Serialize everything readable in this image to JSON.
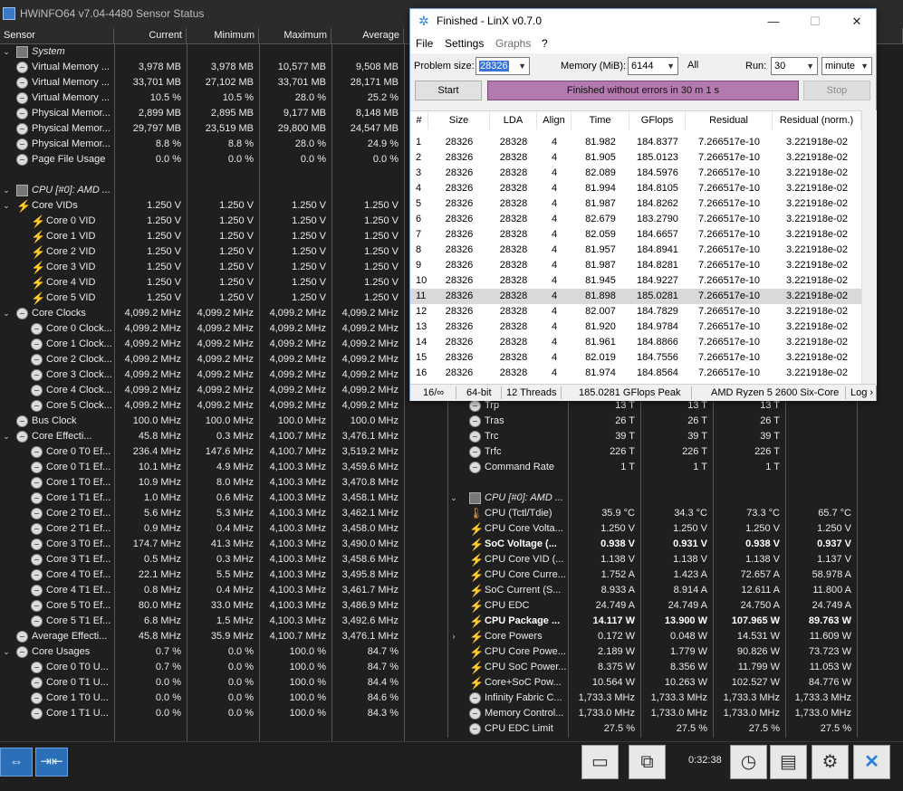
{
  "hwinfo": {
    "title": "HWiNFO64 v7.04-4480 Sensor Status",
    "columns": [
      "Sensor",
      "Current",
      "Minimum",
      "Maximum",
      "Average"
    ],
    "left_rows": [
      {
        "indent": 0,
        "kind": "group",
        "icon": "chip-icon",
        "label": "System",
        "cur": "",
        "min": "",
        "max": "",
        "avg": ""
      },
      {
        "indent": 1,
        "kind": "item",
        "icon": "circle-gauge-icon",
        "label": "Virtual Memory ...",
        "cur": "3,978 MB",
        "min": "3,978 MB",
        "max": "10,577 MB",
        "avg": "9,508 MB"
      },
      {
        "indent": 1,
        "kind": "item",
        "icon": "circle-gauge-icon",
        "label": "Virtual Memory ...",
        "cur": "33,701 MB",
        "min": "27,102 MB",
        "max": "33,701 MB",
        "avg": "28,171 MB"
      },
      {
        "indent": 1,
        "kind": "item",
        "icon": "circle-gauge-icon",
        "label": "Virtual Memory ...",
        "cur": "10.5 %",
        "min": "10.5 %",
        "max": "28.0 %",
        "avg": "25.2 %"
      },
      {
        "indent": 1,
        "kind": "item",
        "icon": "circle-gauge-icon",
        "label": "Physical Memor...",
        "cur": "2,899 MB",
        "min": "2,895 MB",
        "max": "9,177 MB",
        "avg": "8,148 MB"
      },
      {
        "indent": 1,
        "kind": "item",
        "icon": "circle-gauge-icon",
        "label": "Physical Memor...",
        "cur": "29,797 MB",
        "min": "23,519 MB",
        "max": "29,800 MB",
        "avg": "24,547 MB"
      },
      {
        "indent": 1,
        "kind": "item",
        "icon": "circle-gauge-icon",
        "label": "Physical Memor...",
        "cur": "8.8 %",
        "min": "8.8 %",
        "max": "28.0 %",
        "avg": "24.9 %"
      },
      {
        "indent": 1,
        "kind": "item",
        "icon": "circle-gauge-icon",
        "label": "Page File Usage",
        "cur": "0.0 %",
        "min": "0.0 %",
        "max": "0.0 %",
        "avg": "0.0 %"
      },
      {
        "indent": 0,
        "kind": "blank",
        "icon": "",
        "label": "",
        "cur": "",
        "min": "",
        "max": "",
        "avg": ""
      },
      {
        "indent": 0,
        "kind": "group",
        "icon": "chip-icon",
        "label": "CPU [#0]: AMD ...",
        "cur": "",
        "min": "",
        "max": "",
        "avg": ""
      },
      {
        "indent": 1,
        "kind": "parent",
        "icon": "bolt-icon",
        "label": "Core VIDs",
        "cur": "1.250 V",
        "min": "1.250 V",
        "max": "1.250 V",
        "avg": "1.250 V"
      },
      {
        "indent": 2,
        "kind": "item",
        "icon": "bolt-icon",
        "label": "Core 0 VID",
        "cur": "1.250 V",
        "min": "1.250 V",
        "max": "1.250 V",
        "avg": "1.250 V"
      },
      {
        "indent": 2,
        "kind": "item",
        "icon": "bolt-icon",
        "label": "Core 1 VID",
        "cur": "1.250 V",
        "min": "1.250 V",
        "max": "1.250 V",
        "avg": "1.250 V"
      },
      {
        "indent": 2,
        "kind": "item",
        "icon": "bolt-icon",
        "label": "Core 2 VID",
        "cur": "1.250 V",
        "min": "1.250 V",
        "max": "1.250 V",
        "avg": "1.250 V"
      },
      {
        "indent": 2,
        "kind": "item",
        "icon": "bolt-icon",
        "label": "Core 3 VID",
        "cur": "1.250 V",
        "min": "1.250 V",
        "max": "1.250 V",
        "avg": "1.250 V"
      },
      {
        "indent": 2,
        "kind": "item",
        "icon": "bolt-icon",
        "label": "Core 4 VID",
        "cur": "1.250 V",
        "min": "1.250 V",
        "max": "1.250 V",
        "avg": "1.250 V"
      },
      {
        "indent": 2,
        "kind": "item",
        "icon": "bolt-icon",
        "label": "Core 5 VID",
        "cur": "1.250 V",
        "min": "1.250 V",
        "max": "1.250 V",
        "avg": "1.250 V"
      },
      {
        "indent": 1,
        "kind": "parent",
        "icon": "circle-gauge-icon",
        "label": "Core Clocks",
        "cur": "4,099.2 MHz",
        "min": "4,099.2 MHz",
        "max": "4,099.2 MHz",
        "avg": "4,099.2 MHz"
      },
      {
        "indent": 2,
        "kind": "item",
        "icon": "circle-gauge-icon",
        "label": "Core 0 Clock...",
        "cur": "4,099.2 MHz",
        "min": "4,099.2 MHz",
        "max": "4,099.2 MHz",
        "avg": "4,099.2 MHz"
      },
      {
        "indent": 2,
        "kind": "item",
        "icon": "circle-gauge-icon",
        "label": "Core 1 Clock...",
        "cur": "4,099.2 MHz",
        "min": "4,099.2 MHz",
        "max": "4,099.2 MHz",
        "avg": "4,099.2 MHz"
      },
      {
        "indent": 2,
        "kind": "item",
        "icon": "circle-gauge-icon",
        "label": "Core 2 Clock...",
        "cur": "4,099.2 MHz",
        "min": "4,099.2 MHz",
        "max": "4,099.2 MHz",
        "avg": "4,099.2 MHz"
      },
      {
        "indent": 2,
        "kind": "item",
        "icon": "circle-gauge-icon",
        "label": "Core 3 Clock...",
        "cur": "4,099.2 MHz",
        "min": "4,099.2 MHz",
        "max": "4,099.2 MHz",
        "avg": "4,099.2 MHz"
      },
      {
        "indent": 2,
        "kind": "item",
        "icon": "circle-gauge-icon",
        "label": "Core 4 Clock...",
        "cur": "4,099.2 MHz",
        "min": "4,099.2 MHz",
        "max": "4,099.2 MHz",
        "avg": "4,099.2 MHz"
      },
      {
        "indent": 2,
        "kind": "item",
        "icon": "circle-gauge-icon",
        "label": "Core 5 Clock...",
        "cur": "4,099.2 MHz",
        "min": "4,099.2 MHz",
        "max": "4,099.2 MHz",
        "avg": "4,099.2 MHz"
      },
      {
        "indent": 1,
        "kind": "item",
        "icon": "circle-gauge-icon",
        "label": "Bus Clock",
        "cur": "100.0 MHz",
        "min": "100.0 MHz",
        "max": "100.0 MHz",
        "avg": "100.0 MHz"
      },
      {
        "indent": 1,
        "kind": "parent",
        "icon": "circle-gauge-icon",
        "label": "Core Effecti...",
        "cur": "45.8 MHz",
        "min": "0.3 MHz",
        "max": "4,100.7 MHz",
        "avg": "3,476.1 MHz"
      },
      {
        "indent": 2,
        "kind": "item",
        "icon": "circle-gauge-icon",
        "label": "Core 0 T0 Ef...",
        "cur": "236.4 MHz",
        "min": "147.6 MHz",
        "max": "4,100.7 MHz",
        "avg": "3,519.2 MHz"
      },
      {
        "indent": 2,
        "kind": "item",
        "icon": "circle-gauge-icon",
        "label": "Core 0 T1 Ef...",
        "cur": "10.1 MHz",
        "min": "4.9 MHz",
        "max": "4,100.3 MHz",
        "avg": "3,459.6 MHz"
      },
      {
        "indent": 2,
        "kind": "item",
        "icon": "circle-gauge-icon",
        "label": "Core 1 T0 Ef...",
        "cur": "10.9 MHz",
        "min": "8.0 MHz",
        "max": "4,100.3 MHz",
        "avg": "3,470.8 MHz"
      },
      {
        "indent": 2,
        "kind": "item",
        "icon": "circle-gauge-icon",
        "label": "Core 1 T1 Ef...",
        "cur": "1.0 MHz",
        "min": "0.6 MHz",
        "max": "4,100.3 MHz",
        "avg": "3,458.1 MHz"
      },
      {
        "indent": 2,
        "kind": "item",
        "icon": "circle-gauge-icon",
        "label": "Core 2 T0 Ef...",
        "cur": "5.6 MHz",
        "min": "5.3 MHz",
        "max": "4,100.3 MHz",
        "avg": "3,462.1 MHz"
      },
      {
        "indent": 2,
        "kind": "item",
        "icon": "circle-gauge-icon",
        "label": "Core 2 T1 Ef...",
        "cur": "0.9 MHz",
        "min": "0.4 MHz",
        "max": "4,100.3 MHz",
        "avg": "3,458.0 MHz"
      },
      {
        "indent": 2,
        "kind": "item",
        "icon": "circle-gauge-icon",
        "label": "Core 3 T0 Ef...",
        "cur": "174.7 MHz",
        "min": "41.3 MHz",
        "max": "4,100.3 MHz",
        "avg": "3,490.0 MHz"
      },
      {
        "indent": 2,
        "kind": "item",
        "icon": "circle-gauge-icon",
        "label": "Core 3 T1 Ef...",
        "cur": "0.5 MHz",
        "min": "0.3 MHz",
        "max": "4,100.3 MHz",
        "avg": "3,458.6 MHz"
      },
      {
        "indent": 2,
        "kind": "item",
        "icon": "circle-gauge-icon",
        "label": "Core 4 T0 Ef...",
        "cur": "22.1 MHz",
        "min": "5.5 MHz",
        "max": "4,100.3 MHz",
        "avg": "3,495.8 MHz"
      },
      {
        "indent": 2,
        "kind": "item",
        "icon": "circle-gauge-icon",
        "label": "Core 4 T1 Ef...",
        "cur": "0.8 MHz",
        "min": "0.4 MHz",
        "max": "4,100.3 MHz",
        "avg": "3,461.7 MHz"
      },
      {
        "indent": 2,
        "kind": "item",
        "icon": "circle-gauge-icon",
        "label": "Core 5 T0 Ef...",
        "cur": "80.0 MHz",
        "min": "33.0 MHz",
        "max": "4,100.3 MHz",
        "avg": "3,486.9 MHz"
      },
      {
        "indent": 2,
        "kind": "item",
        "icon": "circle-gauge-icon",
        "label": "Core 5 T1 Ef...",
        "cur": "6.8 MHz",
        "min": "1.5 MHz",
        "max": "4,100.3 MHz",
        "avg": "3,492.6 MHz"
      },
      {
        "indent": 1,
        "kind": "item",
        "icon": "circle-gauge-icon",
        "label": "Average Effecti...",
        "cur": "45.8 MHz",
        "min": "35.9 MHz",
        "max": "4,100.7 MHz",
        "avg": "3,476.1 MHz"
      },
      {
        "indent": 1,
        "kind": "parent",
        "icon": "circle-gauge-icon",
        "label": "Core Usages",
        "cur": "0.7 %",
        "min": "0.0 %",
        "max": "100.0 %",
        "avg": "84.7 %"
      },
      {
        "indent": 2,
        "kind": "item",
        "icon": "circle-gauge-icon",
        "label": "Core 0 T0 U...",
        "cur": "0.7 %",
        "min": "0.0 %",
        "max": "100.0 %",
        "avg": "84.7 %"
      },
      {
        "indent": 2,
        "kind": "item",
        "icon": "circle-gauge-icon",
        "label": "Core 0 T1 U...",
        "cur": "0.0 %",
        "min": "0.0 %",
        "max": "100.0 %",
        "avg": "84.4 %"
      },
      {
        "indent": 2,
        "kind": "item",
        "icon": "circle-gauge-icon",
        "label": "Core 1 T0 U...",
        "cur": "0.0 %",
        "min": "0.0 %",
        "max": "100.0 %",
        "avg": "84.6 %"
      },
      {
        "indent": 2,
        "kind": "item",
        "icon": "circle-gauge-icon",
        "label": "Core 1 T1 U...",
        "cur": "0.0 %",
        "min": "0.0 %",
        "max": "100.0 %",
        "avg": "84.3 %"
      }
    ],
    "right_rows": [
      {
        "indent": 1,
        "kind": "item",
        "icon": "circle-gauge-icon",
        "bold": false,
        "label": "Trp",
        "cur": "13 T",
        "min": "13 T",
        "max": "13 T",
        "avg": ""
      },
      {
        "indent": 1,
        "kind": "item",
        "icon": "circle-gauge-icon",
        "bold": false,
        "label": "Tras",
        "cur": "26 T",
        "min": "26 T",
        "max": "26 T",
        "avg": ""
      },
      {
        "indent": 1,
        "kind": "item",
        "icon": "circle-gauge-icon",
        "bold": false,
        "label": "Trc",
        "cur": "39 T",
        "min": "39 T",
        "max": "39 T",
        "avg": ""
      },
      {
        "indent": 1,
        "kind": "item",
        "icon": "circle-gauge-icon",
        "bold": false,
        "label": "Trfc",
        "cur": "226 T",
        "min": "226 T",
        "max": "226 T",
        "avg": ""
      },
      {
        "indent": 1,
        "kind": "item",
        "icon": "circle-gauge-icon",
        "bold": false,
        "label": "Command Rate",
        "cur": "1 T",
        "min": "1 T",
        "max": "1 T",
        "avg": ""
      },
      {
        "indent": 0,
        "kind": "blank",
        "icon": "",
        "bold": false,
        "label": "",
        "cur": "",
        "min": "",
        "max": "",
        "avg": ""
      },
      {
        "indent": 0,
        "kind": "group",
        "icon": "chip-icon",
        "bold": false,
        "label": "CPU [#0]: AMD ...",
        "cur": "",
        "min": "",
        "max": "",
        "avg": ""
      },
      {
        "indent": 1,
        "kind": "item",
        "icon": "thermometer-icon",
        "bold": false,
        "label": "CPU (Tctl/Tdie)",
        "cur": "35.9 °C",
        "min": "34.3 °C",
        "max": "73.3 °C",
        "avg": "65.7 °C"
      },
      {
        "indent": 1,
        "kind": "item",
        "icon": "bolt-icon",
        "bold": false,
        "label": "CPU Core Volta...",
        "cur": "1.250 V",
        "min": "1.250 V",
        "max": "1.250 V",
        "avg": "1.250 V"
      },
      {
        "indent": 1,
        "kind": "item",
        "icon": "bolt-icon",
        "bold": true,
        "label": "SoC Voltage (...",
        "cur": "0.938 V",
        "min": "0.931 V",
        "max": "0.938 V",
        "avg": "0.937 V"
      },
      {
        "indent": 1,
        "kind": "item",
        "icon": "bolt-icon",
        "bold": false,
        "label": "CPU Core VID (...",
        "cur": "1.138 V",
        "min": "1.138 V",
        "max": "1.138 V",
        "avg": "1.137 V"
      },
      {
        "indent": 1,
        "kind": "item",
        "icon": "bolt-icon",
        "bold": false,
        "label": "CPU Core Curre...",
        "cur": "1.752 A",
        "min": "1.423 A",
        "max": "72.657 A",
        "avg": "58.978 A"
      },
      {
        "indent": 1,
        "kind": "item",
        "icon": "bolt-icon",
        "bold": false,
        "label": "SoC Current (S...",
        "cur": "8.933 A",
        "min": "8.914 A",
        "max": "12.611 A",
        "avg": "11.800 A"
      },
      {
        "indent": 1,
        "kind": "item",
        "icon": "bolt-icon",
        "bold": false,
        "label": "CPU EDC",
        "cur": "24.749 A",
        "min": "24.749 A",
        "max": "24.750 A",
        "avg": "24.749 A"
      },
      {
        "indent": 1,
        "kind": "item",
        "icon": "bolt-icon",
        "bold": true,
        "label": "CPU Package ...",
        "cur": "14.117 W",
        "min": "13.900 W",
        "max": "107.965 W",
        "avg": "89.763 W"
      },
      {
        "indent": 1,
        "kind": "parent-collapsed",
        "icon": "bolt-icon",
        "bold": false,
        "label": "Core Powers",
        "cur": "0.172 W",
        "min": "0.048 W",
        "max": "14.531 W",
        "avg": "11.609 W"
      },
      {
        "indent": 1,
        "kind": "item",
        "icon": "bolt-icon",
        "bold": false,
        "label": "CPU Core Powe...",
        "cur": "2.189 W",
        "min": "1.779 W",
        "max": "90.826 W",
        "avg": "73.723 W"
      },
      {
        "indent": 1,
        "kind": "item",
        "icon": "bolt-icon",
        "bold": false,
        "label": "CPU SoC Power...",
        "cur": "8.375 W",
        "min": "8.356 W",
        "max": "11.799 W",
        "avg": "11.053 W"
      },
      {
        "indent": 1,
        "kind": "item",
        "icon": "bolt-icon",
        "bold": false,
        "label": "Core+SoC Pow...",
        "cur": "10.564 W",
        "min": "10.263 W",
        "max": "102.527 W",
        "avg": "84.776 W"
      },
      {
        "indent": 1,
        "kind": "item",
        "icon": "circle-gauge-icon",
        "bold": false,
        "label": "Infinity Fabric C...",
        "cur": "1,733.3 MHz",
        "min": "1,733.3 MHz",
        "max": "1,733.3 MHz",
        "avg": "1,733.3 MHz"
      },
      {
        "indent": 1,
        "kind": "item",
        "icon": "circle-gauge-icon",
        "bold": false,
        "label": "Memory Control...",
        "cur": "1,733.0 MHz",
        "min": "1,733.0 MHz",
        "max": "1,733.0 MHz",
        "avg": "1,733.0 MHz"
      },
      {
        "indent": 1,
        "kind": "item",
        "icon": "circle-gauge-icon",
        "bold": false,
        "label": "CPU EDC Limit",
        "cur": "27.5 %",
        "min": "27.5 %",
        "max": "27.5 %",
        "avg": "27.5 %"
      }
    ],
    "timer": "0:32:38"
  },
  "linx": {
    "title": "Finished - LinX v0.7.0",
    "menu": [
      "File",
      "Settings",
      "Graphs",
      "?"
    ],
    "problem_size_label": "Problem size:",
    "problem_size": "28326",
    "memory_label": "Memory (MiB):",
    "memory": "6144",
    "all_label": "All",
    "run_label": "Run:",
    "run_count": "30",
    "run_unit": "minute",
    "start_label": "Start",
    "stop_label": "Stop",
    "status": "Finished without errors in 30 m 1 s",
    "columns": [
      "#",
      "Size",
      "LDA",
      "Align",
      "Time",
      "GFlops",
      "Residual",
      "Residual (norm.)"
    ],
    "rows": [
      [
        "1",
        "28326",
        "28328",
        "4",
        "81.982",
        "184.8377",
        "7.266517e-10",
        "3.221918e-02"
      ],
      [
        "2",
        "28326",
        "28328",
        "4",
        "81.905",
        "185.0123",
        "7.266517e-10",
        "3.221918e-02"
      ],
      [
        "3",
        "28326",
        "28328",
        "4",
        "82.089",
        "184.5976",
        "7.266517e-10",
        "3.221918e-02"
      ],
      [
        "4",
        "28326",
        "28328",
        "4",
        "81.994",
        "184.8105",
        "7.266517e-10",
        "3.221918e-02"
      ],
      [
        "5",
        "28326",
        "28328",
        "4",
        "81.987",
        "184.8262",
        "7.266517e-10",
        "3.221918e-02"
      ],
      [
        "6",
        "28326",
        "28328",
        "4",
        "82.679",
        "183.2790",
        "7.266517e-10",
        "3.221918e-02"
      ],
      [
        "7",
        "28326",
        "28328",
        "4",
        "82.059",
        "184.6657",
        "7.266517e-10",
        "3.221918e-02"
      ],
      [
        "8",
        "28326",
        "28328",
        "4",
        "81.957",
        "184.8941",
        "7.266517e-10",
        "3.221918e-02"
      ],
      [
        "9",
        "28326",
        "28328",
        "4",
        "81.987",
        "184.8281",
        "7.266517e-10",
        "3.221918e-02"
      ],
      [
        "10",
        "28326",
        "28328",
        "4",
        "81.945",
        "184.9227",
        "7.266517e-10",
        "3.221918e-02"
      ],
      [
        "11",
        "28326",
        "28328",
        "4",
        "81.898",
        "185.0281",
        "7.266517e-10",
        "3.221918e-02"
      ],
      [
        "12",
        "28326",
        "28328",
        "4",
        "82.007",
        "184.7829",
        "7.266517e-10",
        "3.221918e-02"
      ],
      [
        "13",
        "28326",
        "28328",
        "4",
        "81.920",
        "184.9784",
        "7.266517e-10",
        "3.221918e-02"
      ],
      [
        "14",
        "28326",
        "28328",
        "4",
        "81.961",
        "184.8866",
        "7.266517e-10",
        "3.221918e-02"
      ],
      [
        "15",
        "28326",
        "28328",
        "4",
        "82.019",
        "184.7556",
        "7.266517e-10",
        "3.221918e-02"
      ],
      [
        "16",
        "28326",
        "28328",
        "4",
        "81.974",
        "184.8564",
        "7.266517e-10",
        "3.221918e-02"
      ]
    ],
    "highlighted_row_number": "11",
    "statusbar": {
      "count": "16/∞",
      "bits": "64-bit",
      "threads": "12 Threads",
      "peak": "185.0281 GFlops Peak",
      "cpu": "AMD Ryzen 5 2600 Six-Core",
      "log": "Log ›"
    }
  },
  "colors": {
    "status_purple": "#b37ab0",
    "bolt_yellow": "#ffcc00",
    "accent_blue": "#2b6fb8"
  }
}
